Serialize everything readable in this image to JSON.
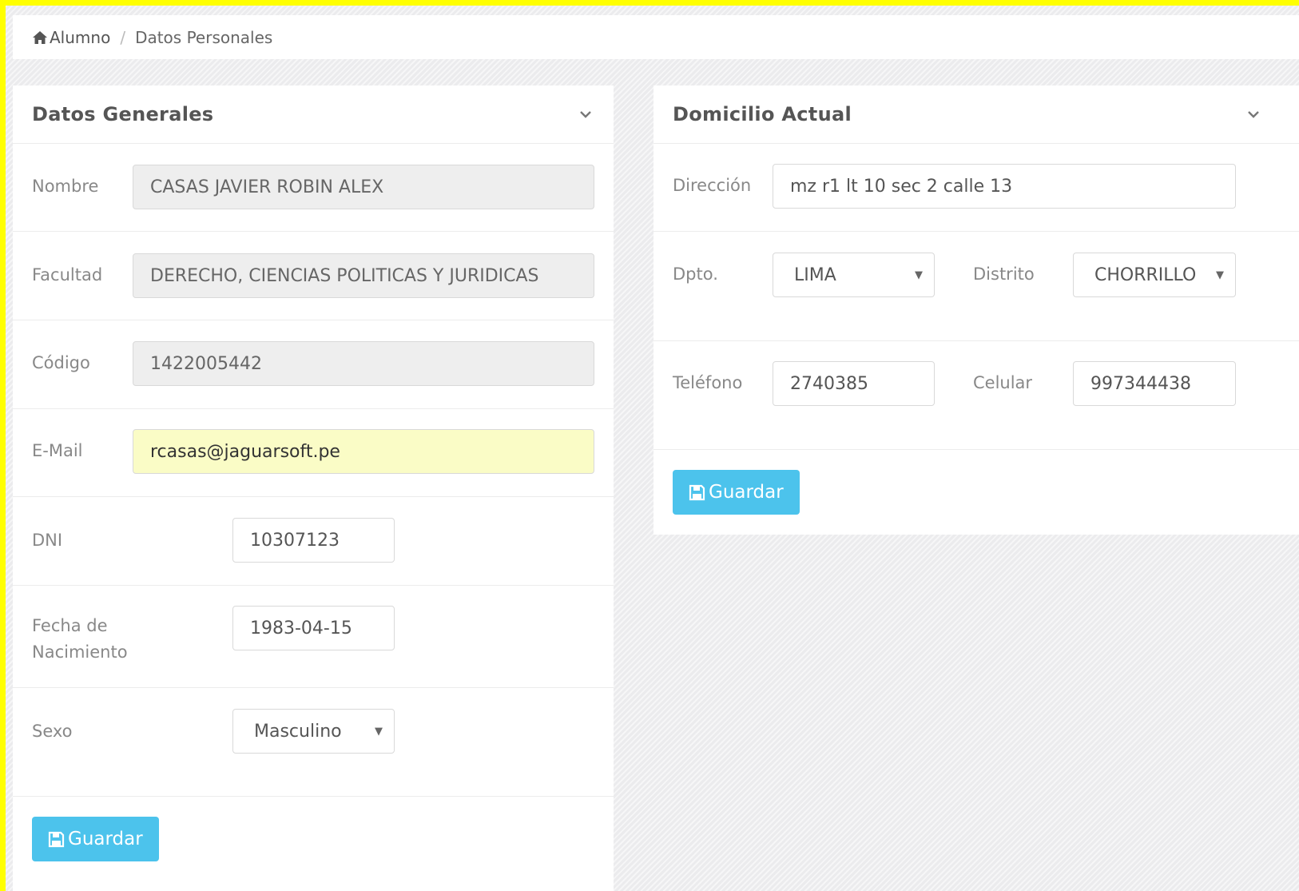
{
  "breadcrumb": {
    "home": "Alumno",
    "separator": "/",
    "current": "Datos Personales"
  },
  "general": {
    "title": "Datos Generales",
    "nombre_label": "Nombre",
    "nombre_value": "CASAS JAVIER ROBIN ALEX",
    "facultad_label": "Facultad",
    "facultad_value": "DERECHO, CIENCIAS POLITICAS Y JURIDICAS",
    "codigo_label": "Código",
    "codigo_value": "1422005442",
    "email_label": "E-Mail",
    "email_value": "rcasas@jaguarsoft.pe",
    "dni_label": "DNI",
    "dni_value": "10307123",
    "fecha_label_1": "Fecha de",
    "fecha_label_2": "Nacimiento",
    "fecha_value": "1983-04-15",
    "sexo_label": "Sexo",
    "sexo_value": "Masculino",
    "save_label": "Guardar"
  },
  "domicilio": {
    "title": "Domicilio Actual",
    "direccion_label": "Dirección",
    "direccion_value": "mz r1 lt 10 sec 2 calle 13",
    "dpto_label": "Dpto.",
    "dpto_value": "LIMA",
    "distrito_label": "Distrito",
    "distrito_value": "CHORRILLO",
    "telefono_label": "Teléfono",
    "telefono_value": "2740385",
    "celular_label": "Celular",
    "celular_value": "997344438",
    "save_label": "Guardar"
  },
  "colors": {
    "frame": "#ffff00",
    "button": "#4cc3ec",
    "autofill": "#fafcc6",
    "readonly": "#eeeeee"
  },
  "icons": [
    "home-icon",
    "chevron-down-icon",
    "save-icon"
  ]
}
